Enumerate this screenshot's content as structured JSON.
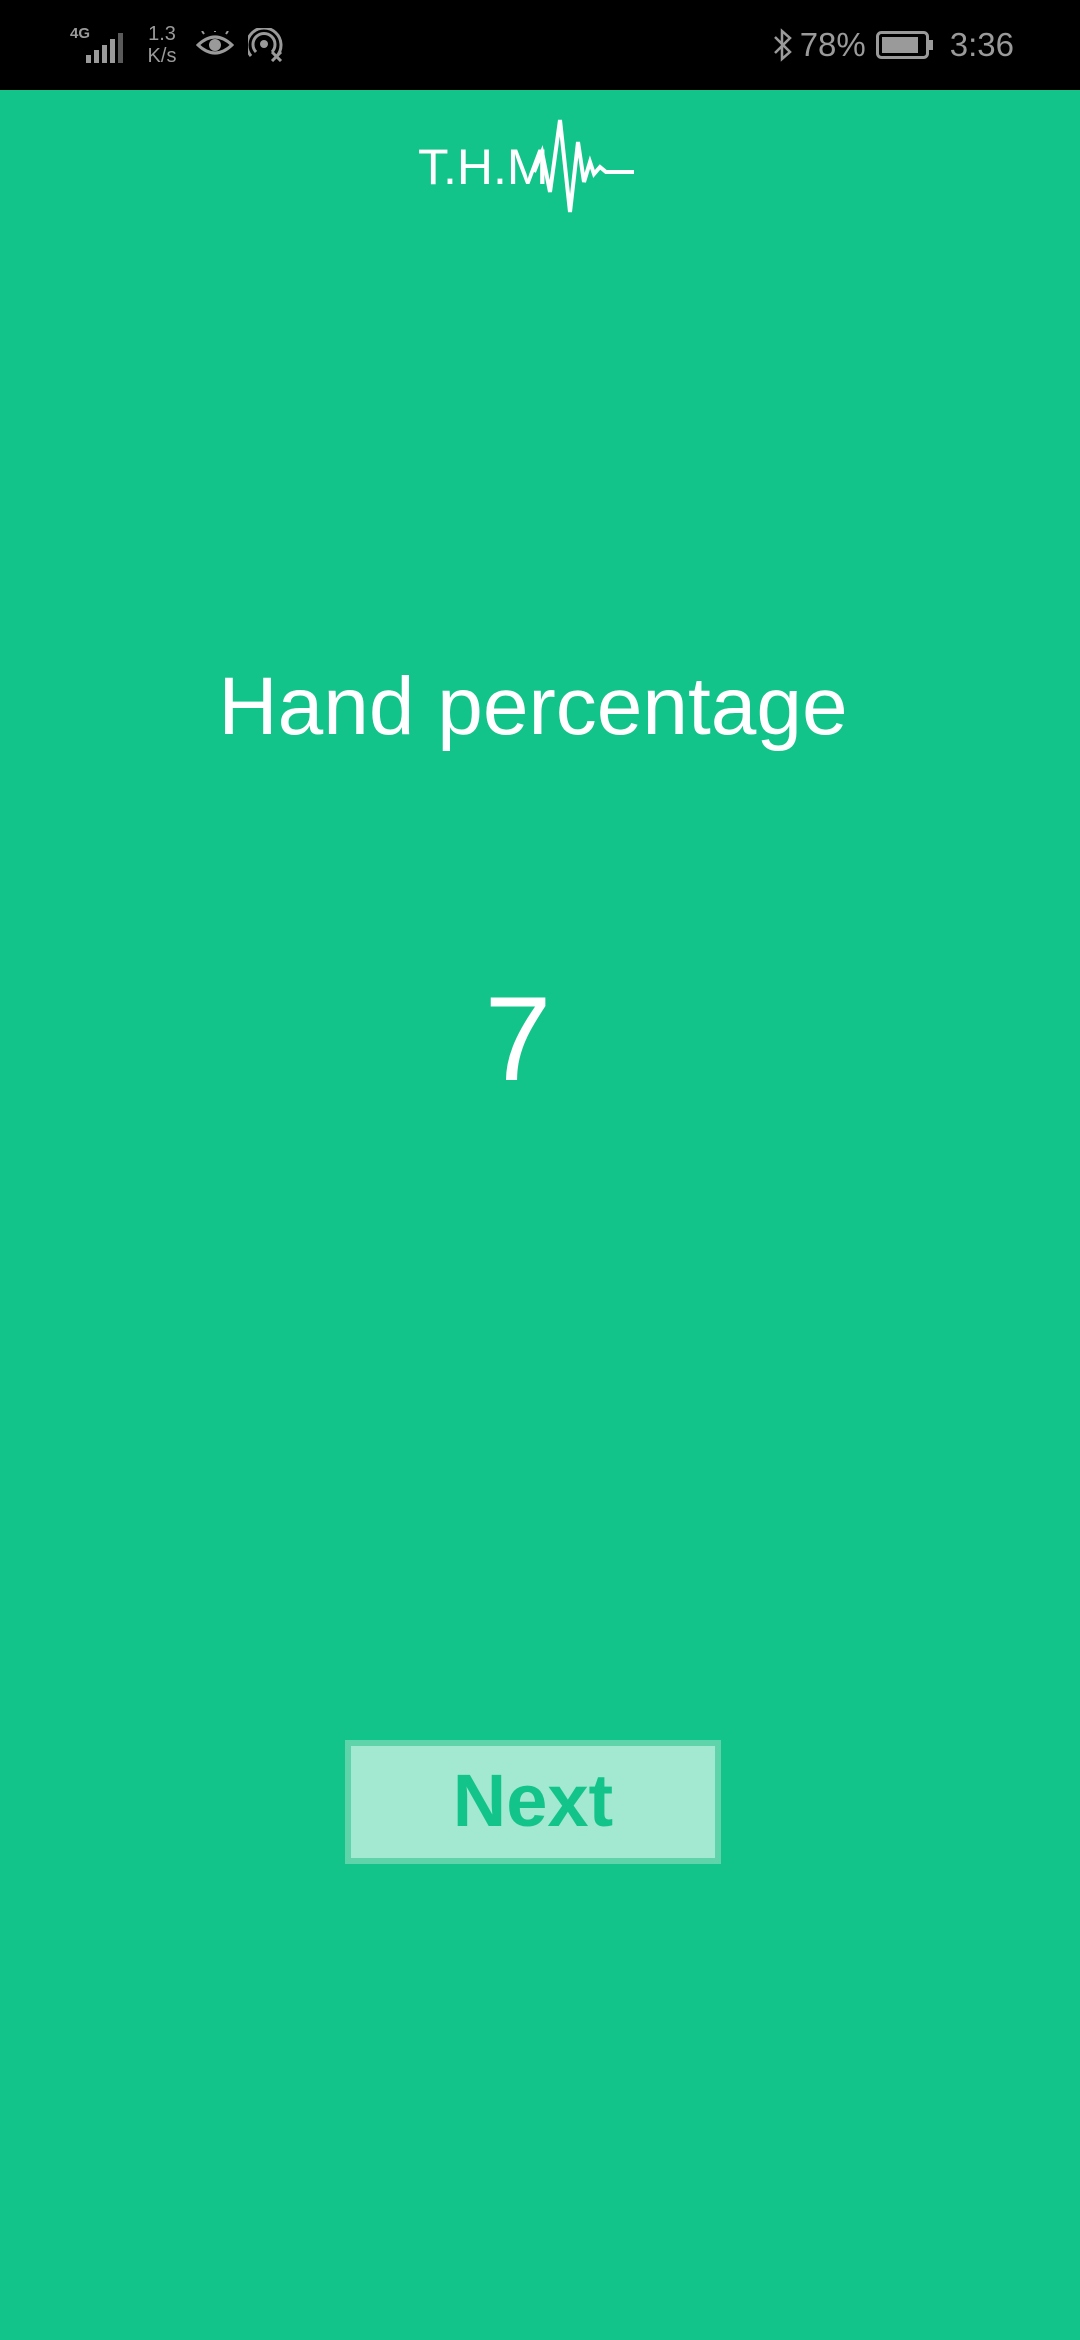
{
  "status_bar": {
    "network_type": "4G",
    "speed_value": "1.3",
    "speed_unit": "K/s",
    "battery_percent": "78%",
    "time": "3:36"
  },
  "logo": {
    "text": "T.H.M"
  },
  "main": {
    "title": "Hand percentage",
    "value": "7"
  },
  "actions": {
    "next_label": "Next"
  },
  "colors": {
    "background": "#13C48A",
    "button_fill": "#A3E8D0",
    "button_text": "#13C48A"
  }
}
